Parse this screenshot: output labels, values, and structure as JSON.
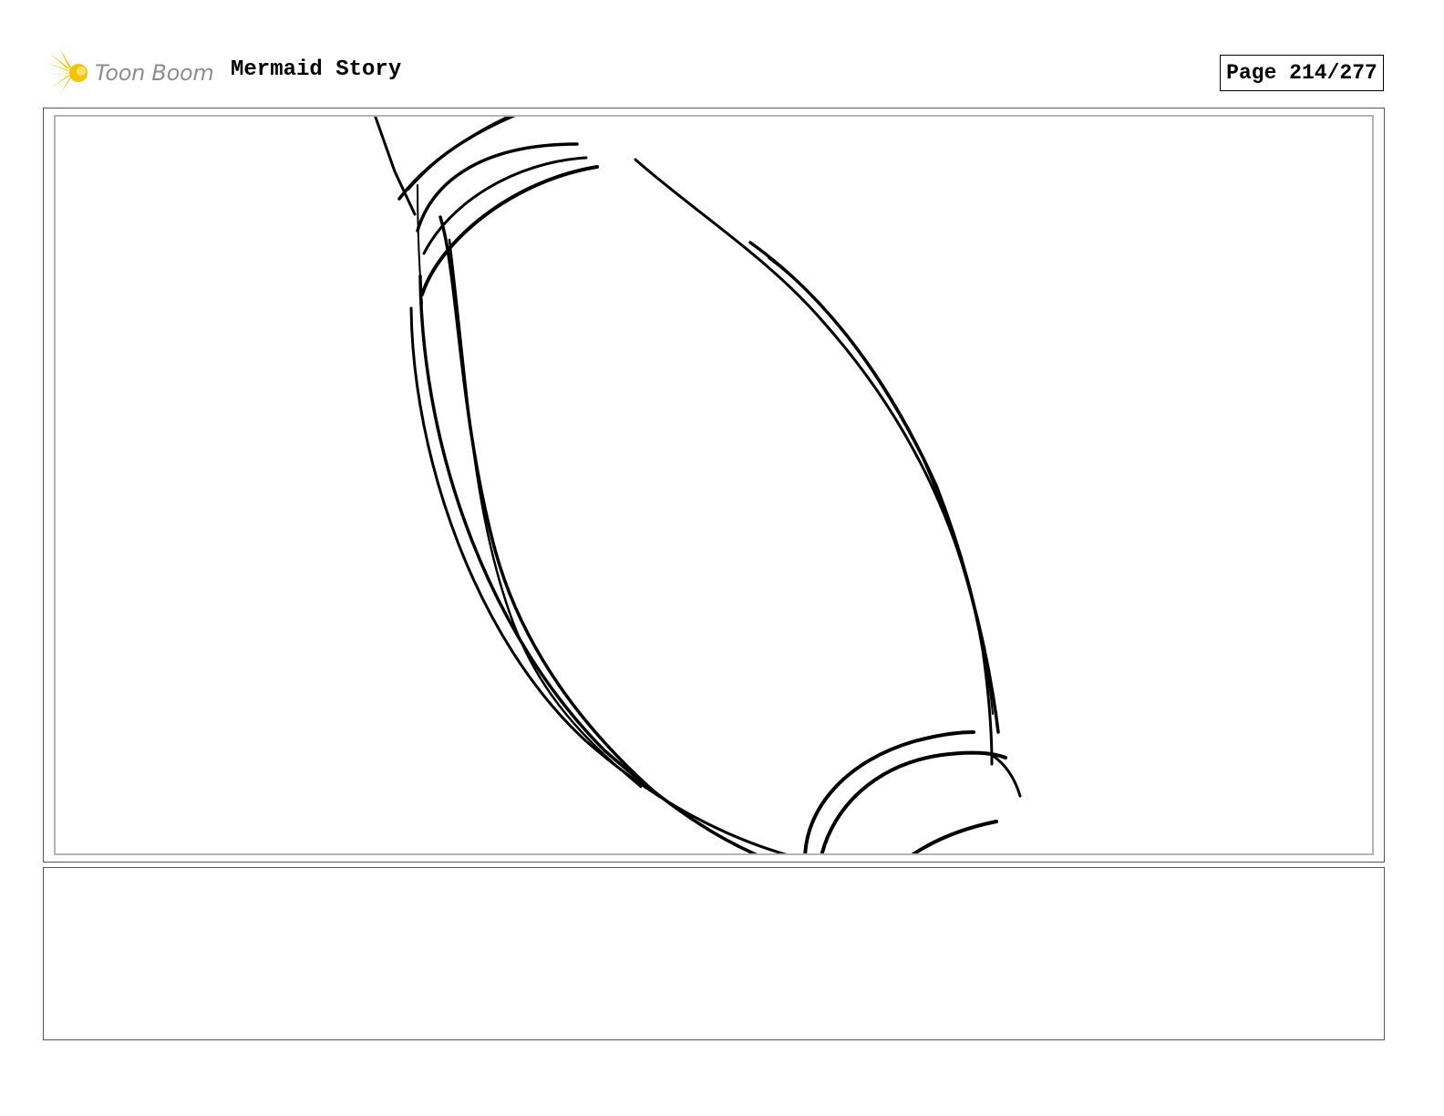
{
  "header": {
    "logo_text": "Toon Boom",
    "project_title": "Mermaid Story",
    "page_label": "Page 214/277"
  },
  "colors": {
    "ink": "#000000",
    "frame_border": "#555555",
    "safe_area_border": "#b3b3b3",
    "logo_star": "#f5c400",
    "logo_text": "#8e8e8e"
  },
  "panel": {
    "description_icon": "pencil-sketch"
  },
  "notes": {
    "text": ""
  }
}
